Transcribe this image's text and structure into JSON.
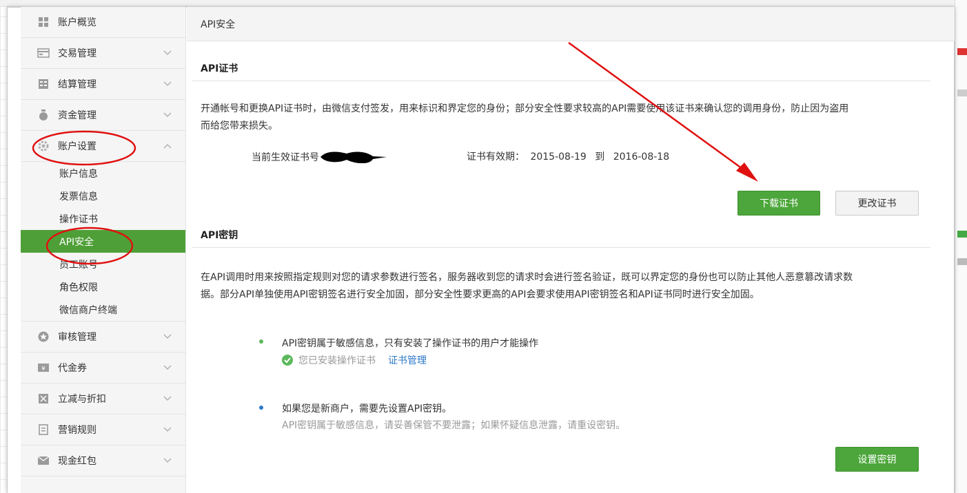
{
  "window": {
    "close_glyph": "✕"
  },
  "sidebar": {
    "items": [
      {
        "label": "账户概览",
        "icon": "grid-icon"
      },
      {
        "label": "交易管理",
        "icon": "card-icon"
      },
      {
        "label": "结算管理",
        "icon": "ledger-icon"
      },
      {
        "label": "资金管理",
        "icon": "money-bag-icon"
      },
      {
        "label": "账户设置",
        "icon": "gear-icon"
      }
    ],
    "sub_items": [
      "账户信息",
      "发票信息",
      "操作证书",
      "API安全",
      "员工账号",
      "角色权限",
      "微信商户终端"
    ],
    "active_sub": "API安全",
    "items_after": [
      {
        "label": "审核管理",
        "icon": "star-circle-icon"
      },
      {
        "label": "代金券",
        "icon": "coupon-icon"
      },
      {
        "label": "立减与折扣",
        "icon": "discount-icon"
      },
      {
        "label": "营销规则",
        "icon": "document-icon"
      },
      {
        "label": "现金红包",
        "icon": "red-envelope-icon"
      }
    ]
  },
  "main": {
    "page_title": "API安全",
    "cert": {
      "heading": "API证书",
      "description_line1": "开通帐号和更换API证书时，由微信支付签发，用来标识和界定您的身份；部分安全性要求较高的API需要使用该证书来确认您的调用身份，防止因为盗用",
      "description_line2": "而给您带来损失。",
      "current_label": "当前生效证书号",
      "validity_label": "证书有效期：",
      "valid_from": "2015-08-19",
      "valid_to_word": "到",
      "valid_to": "2016-08-18",
      "download_button": "下载证书",
      "change_button": "更改证书"
    },
    "key": {
      "heading": "API密钥",
      "description_line1": "在API调用时用来按照指定规则对您的请求参数进行签名，服务器收到您的请求时会进行签名验证，既可以界定您的身份也可以防止其他人恶意篡改请求数",
      "description_line2": "据。部分API单独使用API密钥签名进行安全加固，部分安全性要求更高的API会要求使用API密钥签名和API证书同时进行安全加固。",
      "bullet1_title": "API密钥属于敏感信息，只有安装了操作证书的用户才能操作",
      "bullet1_status": "您已安装操作证书",
      "bullet1_link": "证书管理",
      "bullet2_title": "如果您是新商户，需要先设置API密钥。",
      "bullet2_note": "API密钥属于敏感信息，请妥善保管不要泄露；如果怀疑信息泄露，请重设密钥。",
      "set_key_button": "设置密钥"
    }
  },
  "colors": {
    "accent_green": "#4ca63b",
    "active_sidebar": "#4f9f38",
    "link_blue": "#2d78c8",
    "annotation_red": "#e01010",
    "bullet_blue": "#2d78c8",
    "bullet_green": "#5cb85c"
  }
}
